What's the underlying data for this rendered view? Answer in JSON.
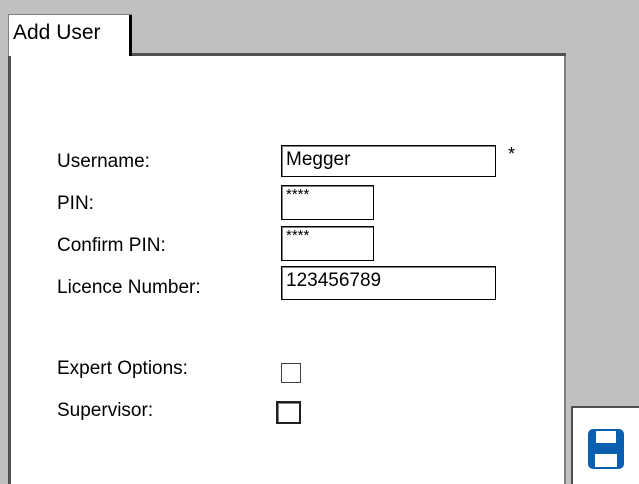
{
  "tab": {
    "label": "Add User"
  },
  "form": {
    "username": {
      "label": "Username:",
      "value": "Megger",
      "required_marker": "*"
    },
    "pin": {
      "label": "PIN:",
      "value": "****"
    },
    "confirm_pin": {
      "label": "Confirm PIN:",
      "value": "****"
    },
    "licence_number": {
      "label": "Licence Number:",
      "value": "123456789"
    },
    "expert_options": {
      "label": "Expert Options:",
      "checked": false
    },
    "supervisor": {
      "label": "Supervisor:",
      "checked": false
    }
  },
  "toolbar": {
    "save_icon": "floppy-disk-icon",
    "save_icon_color": "#0a5fb0"
  },
  "colors": {
    "background": "#c0c0c0",
    "panel": "#ffffff",
    "accent": "#0a5fb0"
  }
}
